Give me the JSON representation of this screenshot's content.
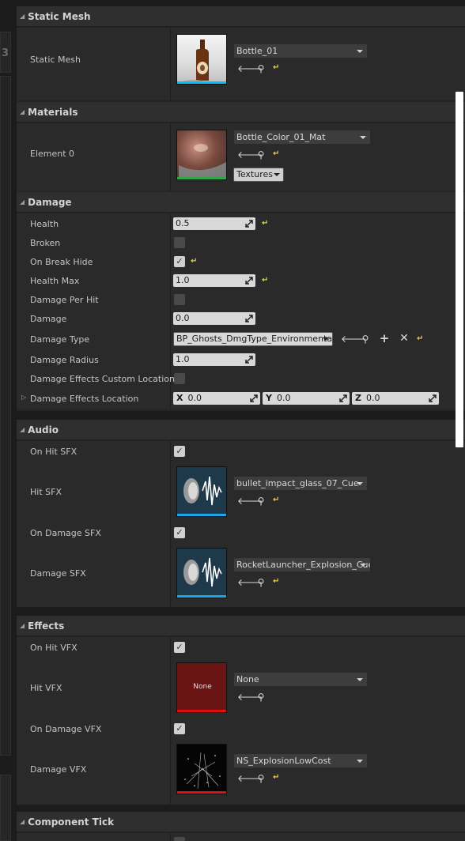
{
  "left_strip": {
    "number": "3"
  },
  "sections": {
    "static_mesh": {
      "title": "Static Mesh",
      "label": "Static Mesh",
      "asset": "Bottle_01"
    },
    "materials": {
      "title": "Materials",
      "label": "Element 0",
      "asset": "Bottle_Color_01_Mat",
      "textures_btn": "Textures"
    },
    "damage": {
      "title": "Damage",
      "health": {
        "label": "Health",
        "value": "0.5"
      },
      "broken": {
        "label": "Broken",
        "checked": false
      },
      "on_break_hide": {
        "label": "On Break Hide",
        "checked": true
      },
      "health_max": {
        "label": "Health Max",
        "value": "1.0"
      },
      "damage_per_hit": {
        "label": "Damage Per Hit",
        "checked": false
      },
      "damage": {
        "label": "Damage",
        "value": "0.0"
      },
      "damage_type": {
        "label": "Damage Type",
        "value": "BP_Ghosts_DmgType_Environmental"
      },
      "damage_radius": {
        "label": "Damage Radius",
        "value": "1.0"
      },
      "custom_location": {
        "label": "Damage Effects Custom Location",
        "checked": false
      },
      "effects_location": {
        "label": "Damage Effects Location",
        "x_axis": "X",
        "x": "0.0",
        "y_axis": "Y",
        "y": "0.0",
        "z_axis": "Z",
        "z": "0.0"
      }
    },
    "audio": {
      "title": "Audio",
      "on_hit_sfx": {
        "label": "On Hit SFX",
        "checked": true
      },
      "hit_sfx": {
        "label": "Hit SFX",
        "asset": "bullet_impact_glass_07_Cue"
      },
      "on_damage_sfx": {
        "label": "On Damage SFX",
        "checked": true
      },
      "damage_sfx": {
        "label": "Damage SFX",
        "asset": "RocketLauncher_Explosion_Cue"
      }
    },
    "effects": {
      "title": "Effects",
      "on_hit_vfx": {
        "label": "On Hit VFX",
        "checked": true
      },
      "hit_vfx": {
        "label": "Hit VFX",
        "asset": "None",
        "thumb_text": "None"
      },
      "on_damage_vfx": {
        "label": "On Damage VFX",
        "checked": true
      },
      "damage_vfx": {
        "label": "Damage VFX",
        "asset": "NS_ExplosionLowCost"
      }
    },
    "component_tick": {
      "title": "Component Tick"
    }
  },
  "icons": {
    "use_selected": "arrow-left-icon",
    "browse": "search-icon",
    "reset": "reset-to-default-icon",
    "add": "plus-icon",
    "clear": "close-icon"
  },
  "colors": {
    "accent_reset": "#e3d14a",
    "mesh_bar": "#00bfff",
    "material_bar": "#2ea84a",
    "sound_bar": "#1fa6e8",
    "vfx_bar": "#e01010"
  }
}
